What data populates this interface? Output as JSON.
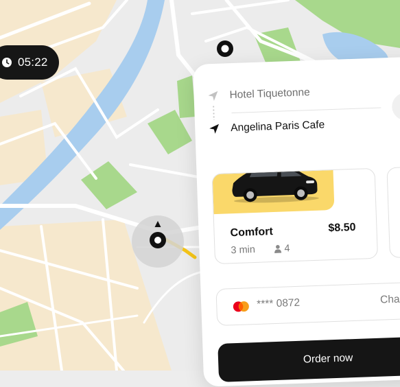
{
  "status": {
    "time": "05:22",
    "clock_icon": "clock-icon"
  },
  "route": {
    "from": "Hotel Tiquetonne",
    "to": "Angelina Paris Cafe",
    "from_icon": "navigation-arrow-outline-icon",
    "to_icon": "navigation-arrow-filled-icon"
  },
  "rides": [
    {
      "name": "Comfort",
      "price": "$8.50",
      "eta": "3 min",
      "seats": "4",
      "selected": true
    }
  ],
  "payment": {
    "card_number": "**** 0872",
    "change_label": "Change",
    "brand_icon": "mastercard-icon"
  },
  "order": {
    "label": "Order now"
  },
  "colors": {
    "accent": "#fad86a",
    "route_line": "#f5c518",
    "dark": "#151515",
    "water": "#a8cdee",
    "park": "#a8d88c",
    "block": "#f6e8cd"
  }
}
